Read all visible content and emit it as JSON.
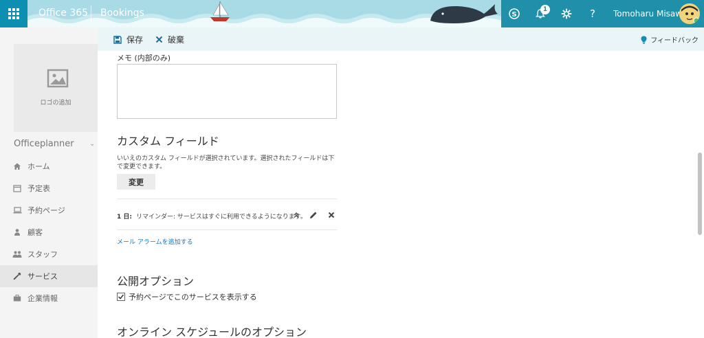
{
  "topbar": {
    "brand": "Office 365",
    "app_name": "Bookings",
    "notification_count": "1",
    "user_name": "Tomoharu Misawa",
    "icons": [
      "waffle-icon",
      "skype-icon",
      "bell-icon",
      "gear-icon",
      "help-icon"
    ],
    "help_glyph": "?"
  },
  "sidebar": {
    "logo_label": "ロゴの追加",
    "org_name": "Officeplanner",
    "items": [
      {
        "label": "ホーム",
        "icon": "home-icon"
      },
      {
        "label": "予定表",
        "icon": "calendar-icon"
      },
      {
        "label": "予約ページ",
        "icon": "laptop-icon"
      },
      {
        "label": "顧客",
        "icon": "person-icon"
      },
      {
        "label": "スタッフ",
        "icon": "people-icon"
      },
      {
        "label": "サービス",
        "icon": "wrench-icon"
      },
      {
        "label": "企業情報",
        "icon": "briefcase-icon"
      }
    ],
    "selected_index": 5
  },
  "commandbar": {
    "save_label": "保存",
    "discard_label": "破棄",
    "feedback_label": "フィードバック"
  },
  "main": {
    "memo_label": "メモ (内部のみ)",
    "memo_value": "",
    "custom_fields_heading": "カスタム フィールド",
    "custom_fields_desc": "いいえのカスタム フィールドが選択されています。選択されたフィールドは下で変更できます。",
    "change_button": "変更",
    "reminder": {
      "day": "1 日:",
      "text": "リマインダー: サービスはすぐに利用できるようになります。"
    },
    "add_mail_alarm": "メール アラームを追加する",
    "publish_heading": "公開オプション",
    "show_on_booking_page": "予約ページでこのサービスを表示する",
    "show_on_booking_page_checked": true,
    "online_schedule_heading": "オンライン スケジュールのオプション"
  },
  "colors": {
    "topbar_bg": "#a9dbe6",
    "waffle_bg": "#0c8fb0",
    "topbar_right_bg": "#1f8faa",
    "commandbar_bg": "#eaf5f8",
    "link": "#1a73b8"
  }
}
